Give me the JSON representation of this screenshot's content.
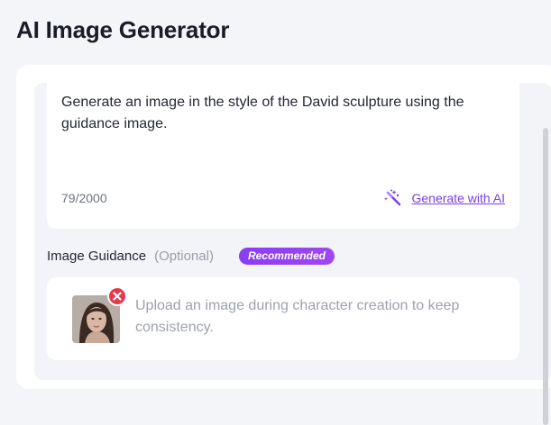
{
  "page": {
    "title": "AI Image Generator"
  },
  "prompt": {
    "text": "Generate an image in the style of the David sculpture using the guidance image.",
    "char_count": "79/2000",
    "generate_with_ai_label": "Generate with AI",
    "generate_icon": "magic-wand-icon"
  },
  "guidance": {
    "title": "Image Guidance",
    "optional_label": "(Optional)",
    "badge_label": "Recommended",
    "upload_placeholder": "Upload an image during character creation to keep consistency.",
    "remove_icon": "close-icon"
  },
  "colors": {
    "accent": "#7b3fe4",
    "badge": "#8a3cf6",
    "remove": "#e23b4e"
  }
}
